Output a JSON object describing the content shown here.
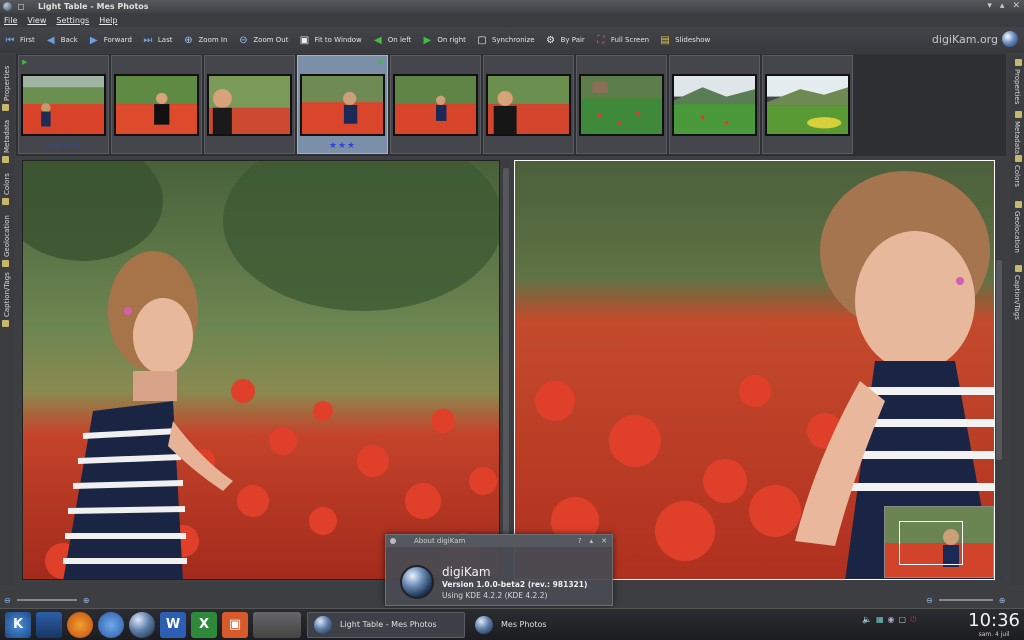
{
  "window": {
    "title": "Light Table - Mes Photos",
    "controls": [
      "▾",
      "▴",
      "✕"
    ]
  },
  "menu": {
    "items": [
      "File",
      "View",
      "Settings",
      "Help"
    ]
  },
  "toolbar": {
    "items": [
      {
        "label": "First",
        "icon": "first-arrow-icon"
      },
      {
        "label": "Back",
        "icon": "back-arrow-icon"
      },
      {
        "label": "Forward",
        "icon": "forward-arrow-icon"
      },
      {
        "label": "Last",
        "icon": "last-arrow-icon"
      },
      {
        "label": "Zoom In",
        "icon": "zoom-in-icon"
      },
      {
        "label": "Zoom Out",
        "icon": "zoom-out-icon"
      },
      {
        "label": "Fit to Window",
        "icon": "fit-window-icon"
      },
      {
        "label": "On left",
        "icon": "arrow-left-icon"
      },
      {
        "label": "On right",
        "icon": "arrow-right-icon"
      },
      {
        "label": "Synchronize",
        "icon": "synchronize-icon"
      },
      {
        "label": "By Pair",
        "icon": "by-pair-icon"
      },
      {
        "label": "Full Screen",
        "icon": "fullscreen-icon"
      },
      {
        "label": "Slideshow",
        "icon": "slideshow-icon"
      }
    ],
    "brand": "digiKam.org"
  },
  "left_tabs": [
    "Properties",
    "Metadata",
    "Colors",
    "Geolocation",
    "Caption/Tags"
  ],
  "right_tabs": [
    "Properties",
    "Metadata",
    "Colors",
    "Geolocation",
    "Caption/Tags"
  ],
  "thumbnails": [
    {
      "scene": "girl-field",
      "rating": "☆☆☆☆",
      "selected": false,
      "markers": "left"
    },
    {
      "scene": "boy-field",
      "rating": "",
      "selected": false,
      "markers": ""
    },
    {
      "scene": "boy-close",
      "rating": "",
      "selected": false,
      "markers": ""
    },
    {
      "scene": "girl-close",
      "rating": "★★★",
      "selected": true,
      "markers": "right"
    },
    {
      "scene": "girl-field",
      "rating": "",
      "selected": false,
      "markers": ""
    },
    {
      "scene": "boy-close",
      "rating": "",
      "selected": false,
      "markers": ""
    },
    {
      "scene": "poppy-house",
      "rating": "",
      "selected": false,
      "markers": ""
    },
    {
      "scene": "landscape-hill",
      "rating": "",
      "selected": false,
      "markers": ""
    },
    {
      "scene": "landscape-yellow",
      "rating": "",
      "selected": false,
      "markers": ""
    }
  ],
  "about": {
    "title": "About digiKam",
    "app_name": "digiKam",
    "version": "Version 1.0.0-beta2 (rev.: 981321)",
    "kde": "Using KDE 4.2.2 (KDE 4.2.2)"
  },
  "taskbar": {
    "tasks": [
      {
        "label": "Light Table - Mes Photos",
        "active": true
      },
      {
        "label": "Mes Photos",
        "active": false
      }
    ],
    "time": "10:36",
    "date": "sam. 4 juil"
  }
}
